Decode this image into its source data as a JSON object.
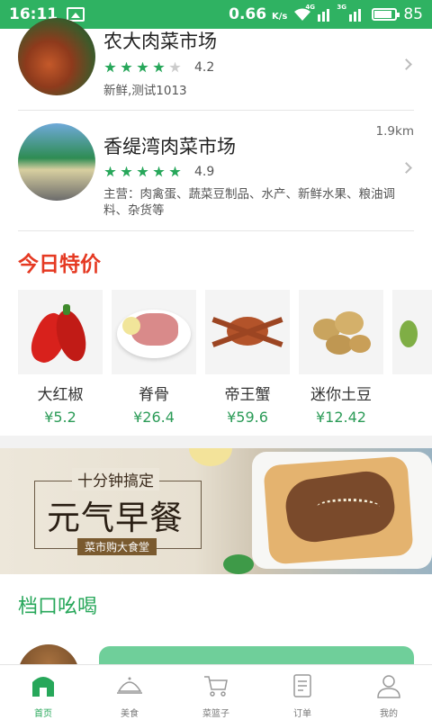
{
  "status_bar": {
    "time": "16:11",
    "speed": "0.66",
    "speed_unit": "K/s",
    "net1": "4G",
    "net2": "3G",
    "battery": "85",
    "battery_level": 0.85
  },
  "markets": [
    {
      "name": "农大肉菜市场",
      "stars": 4,
      "rating": "4.2",
      "desc": "新鲜,测试1013",
      "distance": ""
    },
    {
      "name": "香缇湾肉菜市场",
      "stars": 5,
      "rating": "4.9",
      "desc": "主营：肉禽蛋、蔬菜豆制品、水产、新鲜水果、粮油调料、杂货等",
      "distance": "1.9km"
    }
  ],
  "specials": {
    "title": "今日特价",
    "items": [
      {
        "name": "大红椒",
        "price": "¥5.2"
      },
      {
        "name": "脊骨",
        "price": "¥26.4"
      },
      {
        "name": "帝王蟹",
        "price": "¥59.6"
      },
      {
        "name": "迷你土豆",
        "price": "¥12.42"
      },
      {
        "name": "",
        "price": ""
      }
    ]
  },
  "banner": {
    "subtitle": "十分钟搞定",
    "title": "元气早餐",
    "tagline": "菜市购大食堂"
  },
  "stalls": {
    "title": "档口吆喝"
  },
  "tabbar": [
    {
      "label": "首页",
      "icon": "home-icon",
      "active": true
    },
    {
      "label": "美食",
      "icon": "cloche-icon",
      "active": false
    },
    {
      "label": "菜篮子",
      "icon": "cart-icon",
      "active": false
    },
    {
      "label": "订单",
      "icon": "order-list-icon",
      "active": false
    },
    {
      "label": "我的",
      "icon": "user-icon",
      "active": false
    }
  ],
  "colors": {
    "brand_green": "#2fb262",
    "price_green": "#2b9b57",
    "special_red": "#e53922"
  }
}
